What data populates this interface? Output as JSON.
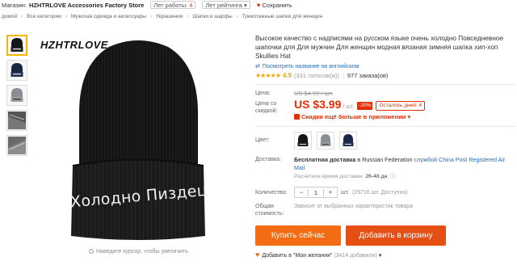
{
  "topbar": {
    "shop_prefix": "Магазин:",
    "store_name": "HZHTRLOVE Accessories Factory Store",
    "years_label": "Лет работы:",
    "years_value": "4",
    "rating_label": "Лет рейтинга",
    "save_label": "Сохранить"
  },
  "breadcrumbs": [
    "домой",
    "Все категории",
    "Мужская одежда и аксессуары",
    "Украшения",
    "Шапки и шарфы",
    "Трикотажные шапки для женщин"
  ],
  "product": {
    "brand_on_image": "HZHTRLOVE",
    "image_text": "Холодно Пиздец",
    "hover_hint": "Наведите курсор, чтобы увеличить",
    "title": "Высокое качество с надписями на русском языке очень холодно Повседневное шапочки для Для мужчин Для женщин модная вязаная зимняя шапка хип-хоп Skullies Hat",
    "translate_link": "Посмотреть название на английском",
    "rating_value": "4.9",
    "rating_votes": "(331 голосов(а))",
    "orders": "977 заказа(ов)",
    "price_label": "Цена:",
    "old_price": "US $4.99 / шт.",
    "discount_price_label": "Цена со скидкой:",
    "price": "US $3.99",
    "price_unit": "/ шт.",
    "discount": "-20%",
    "timer": "Осталось дней: 4",
    "app_deal": "Скидки ещё больше в приложении",
    "color_label": "Цвет:",
    "shipping_label": "Доставка:",
    "shipping_text_1": "Бесплатная доставка",
    "shipping_text_2": "в Russian Federation",
    "shipping_text_3": "службой China Post Registered Air Mail",
    "shipping_time_label": "Расчетное время доставки:",
    "shipping_time": "26-48 дн.",
    "qty_label": "Количество:",
    "qty_value": "1",
    "qty_unit": "шт.",
    "qty_available": "(29716 шт. Доступно)",
    "total_label": "Общая стоимость:",
    "total_text": "Зависит от выбранных характеристик товара",
    "buy_now": "Купить сейчас",
    "add_to_cart": "Добавить в корзину",
    "wishlist": "Добавить в \"Мои желания\"",
    "wishlist_count": "(3414 добавили)"
  },
  "colors": {
    "accent": "#e62e04",
    "buy_button": "#f36b13",
    "cart_button": "#e54f14",
    "link": "#2a6db3",
    "star": "#f7a500"
  }
}
